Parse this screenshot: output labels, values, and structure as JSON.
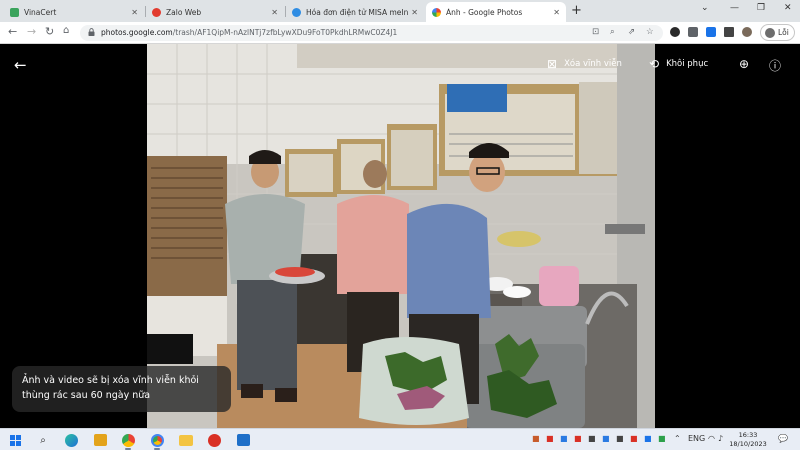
{
  "browser": {
    "tabs": [
      {
        "title": "VinaCert",
        "color": "#3aa35c",
        "active": false
      },
      {
        "title": "Zalo Web",
        "color": "#e23b2f",
        "active": false
      },
      {
        "title": "Hóa đơn điện tử MISA meInvoic",
        "color": "#2f8de3",
        "active": false
      },
      {
        "title": "Ảnh - Google Photos",
        "color": "#fbbc04",
        "active": true
      }
    ],
    "url_host": "photos.google.com",
    "url_path": "/trash/AF1QipM-nAzlNTj7zfbLywXDu9FoT0PkdhLRMwC0Z4J1",
    "profile_label": "Lỗi"
  },
  "viewer": {
    "delete_forever_label": "Xóa vĩnh viễn",
    "restore_label": "Khôi phục",
    "trash_notice": "Ảnh và video sẽ bị xóa vĩnh viễn khỏi thùng rác sau 60 ngày nữa"
  },
  "taskbar": {
    "time": "16:33",
    "date": "18/10/2023"
  },
  "colors": {
    "tabstrip": "#dfe3e6",
    "viewer_bg": "#000000",
    "taskbar": "#e8edf5"
  }
}
